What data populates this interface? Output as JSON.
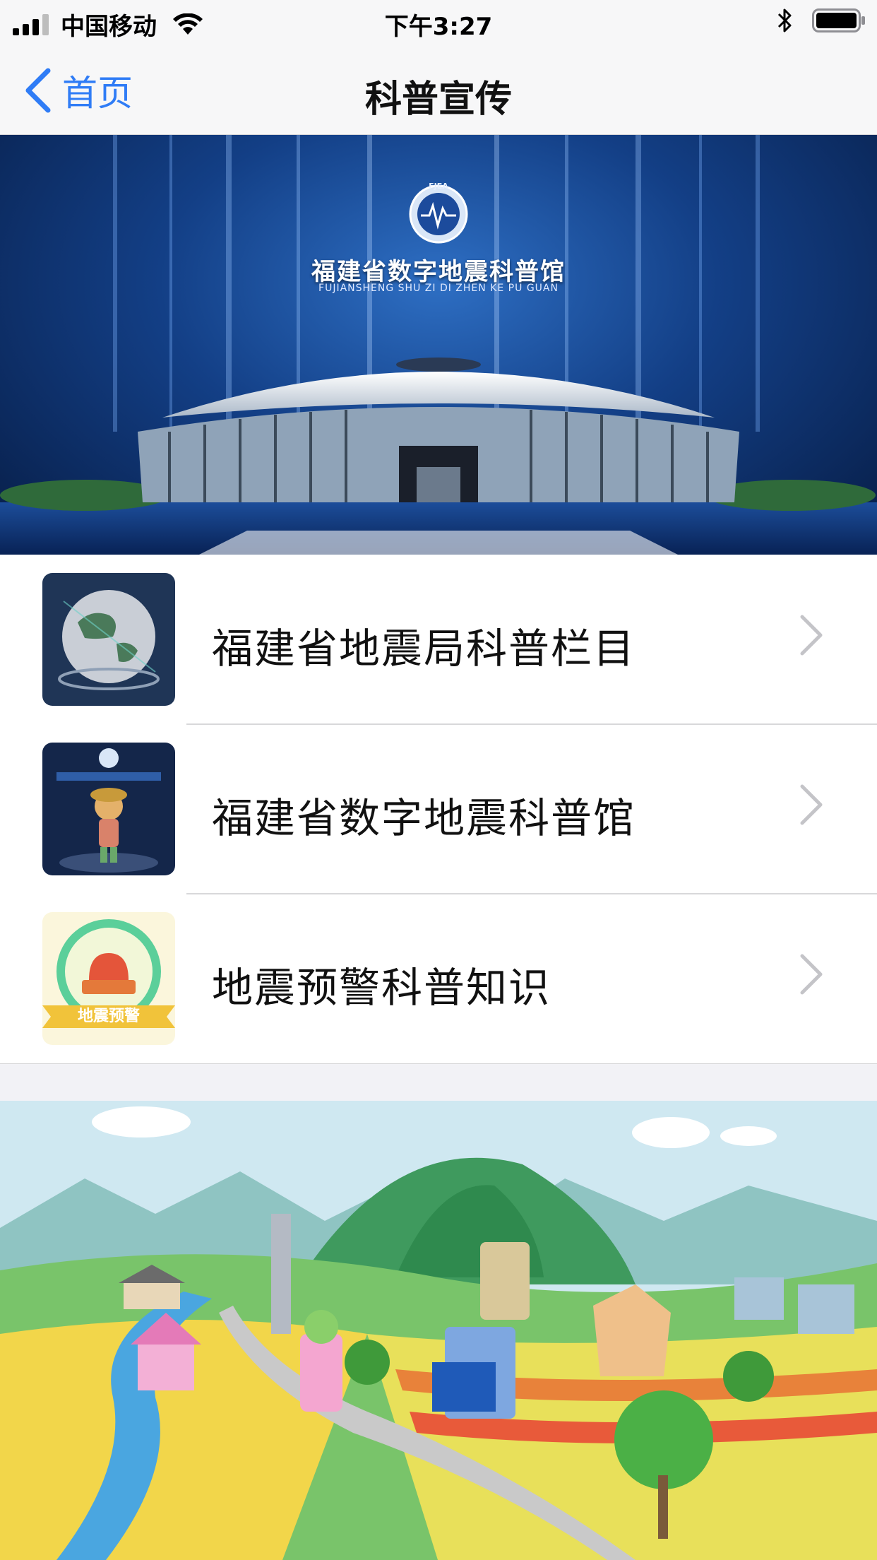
{
  "status_bar": {
    "carrier": "中国移动",
    "time": "下午3:27"
  },
  "nav": {
    "back_label": "首页",
    "title": "科普宣传"
  },
  "banner": {
    "logo_abbr": "FJEA",
    "title": "福建省数字地震科普馆",
    "pinyin": "FUJIANSHENG SHU ZI DI ZHEN KE PU GUAN"
  },
  "list": {
    "items": [
      {
        "label": "福建省地震局科普栏目",
        "icon": "globe-thumbnail"
      },
      {
        "label": "福建省数字地震科普馆",
        "icon": "museum-thumbnail"
      },
      {
        "label": "地震预警科普知识",
        "icon": "earthquake-alert-thumbnail",
        "badge": "地震预警"
      }
    ]
  },
  "colors": {
    "accent": "#2f7cf6",
    "background": "#f2f2f6"
  }
}
